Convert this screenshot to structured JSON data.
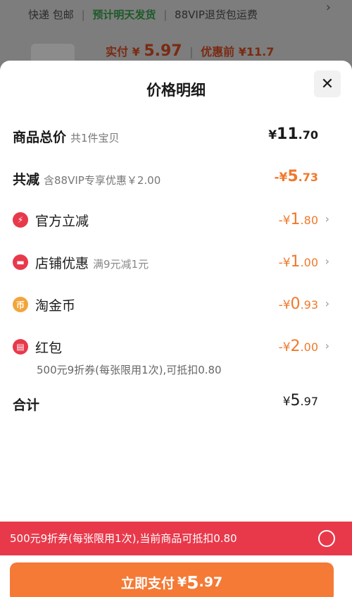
{
  "background": {
    "shipping": "快递 包邮",
    "ship_promise": "预计明天发货",
    "vip_return": "88VIP退货包运费",
    "paid_label": "实付",
    "paid_currency": "¥",
    "paid_amount": "5.97",
    "before_discount": "优惠前 ¥11.7"
  },
  "sheet": {
    "title": "价格明细",
    "close_glyph": "✕"
  },
  "rows": {
    "goods_total": {
      "label": "商品总价",
      "sub": "共1件宝贝",
      "cur": "¥",
      "int": "11",
      "dec": ".70"
    },
    "total_reduce": {
      "label": "共减",
      "sub": "含88VIP专享优惠￥2.00",
      "cur": "-¥",
      "int": "5",
      "dec": ".73"
    }
  },
  "discounts": [
    {
      "label": "官方立减",
      "sub": "",
      "cur": "-¥",
      "int": "1",
      "dec": ".80",
      "icon": "lightning-icon",
      "color": "#e8394b"
    },
    {
      "label": "店铺优惠",
      "sub": "满9元减1元",
      "cur": "-¥",
      "int": "1",
      "dec": ".00",
      "icon": "store-icon",
      "color": "#e8394b"
    },
    {
      "label": "淘金币",
      "sub": "",
      "cur": "-¥",
      "int": "0",
      "dec": ".93",
      "icon": "gold-coin-icon",
      "color": "#f3a53a"
    },
    {
      "label": "红包",
      "sub": "",
      "cur": "-¥",
      "int": "2",
      "dec": ".00",
      "icon": "red-packet-icon",
      "color": "#e8394b"
    }
  ],
  "redpacket_note": "500元9折券(每张限用1次),可抵扣0.80",
  "total": {
    "label": "合计",
    "cur": "¥",
    "int": "5",
    "dec": ".97"
  },
  "coupon_bar": {
    "text": "500元9折券(每张限用1次),当前商品可抵扣0.80"
  },
  "pay_button": {
    "label": "立即支付",
    "cur": "¥",
    "int": "5",
    "dec": ".97"
  },
  "colors": {
    "accent": "#f0792b",
    "coupon": "#e8394b",
    "pay": "#f47a36"
  }
}
